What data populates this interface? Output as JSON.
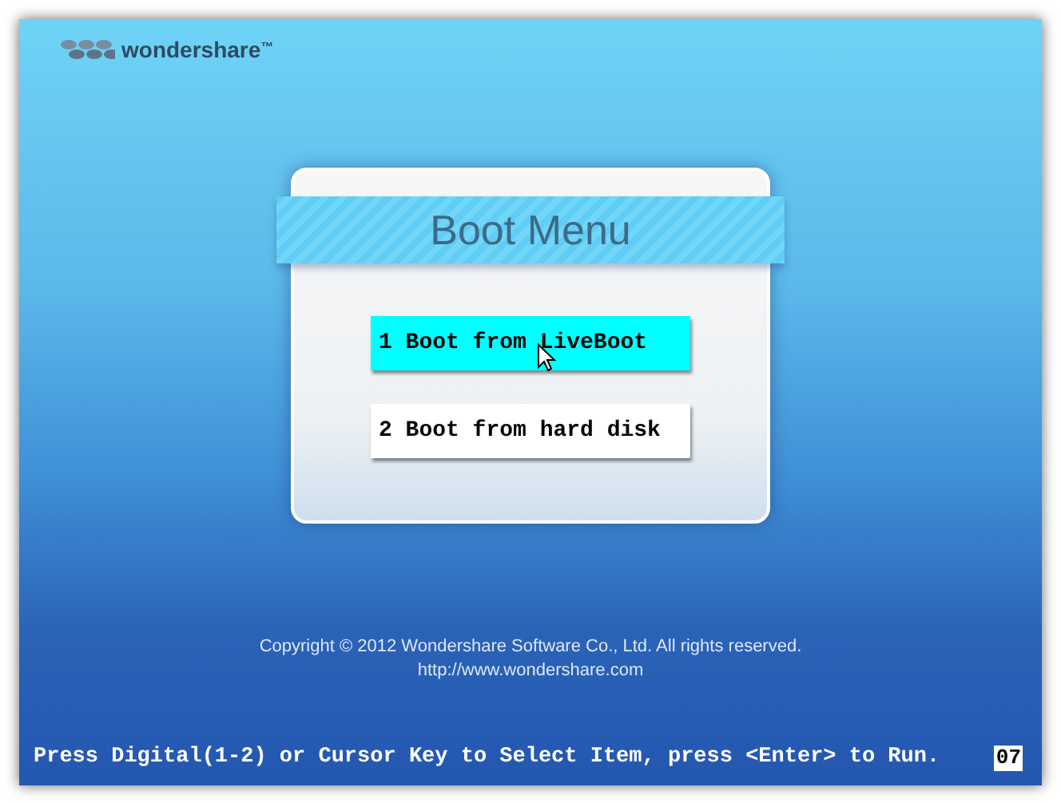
{
  "brand": {
    "name": "wondershare",
    "trademark": "™"
  },
  "menu": {
    "title": "Boot Menu",
    "items": [
      {
        "label": "1 Boot from LiveBoot",
        "selected": true
      },
      {
        "label": "2 Boot from hard disk",
        "selected": false
      }
    ]
  },
  "footer": {
    "copyright": "Copyright © 2012 Wondershare Software Co., Ltd. All rights reserved.",
    "url": "http://www.wondershare.com"
  },
  "status_bar": {
    "hint": "Press Digital(1-2) or Cursor Key to Select Item, press <Enter> to Run.",
    "countdown": "07"
  }
}
